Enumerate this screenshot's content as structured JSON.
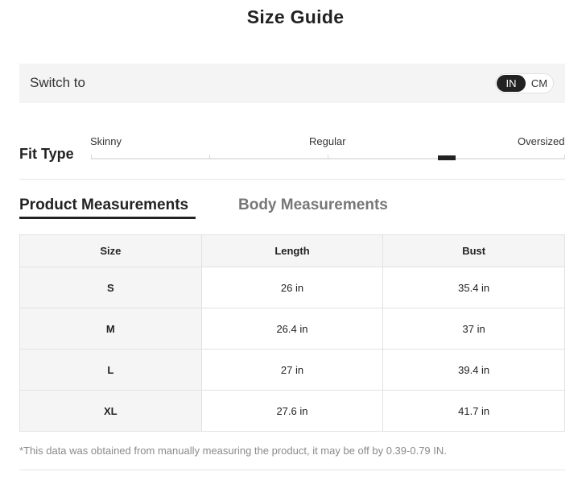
{
  "title": "Size Guide",
  "switch": {
    "label": "Switch to",
    "units": [
      "IN",
      "CM"
    ],
    "selected": "IN"
  },
  "fit": {
    "label": "Fit Type",
    "options": [
      "Skinny",
      "Regular",
      "Oversized"
    ],
    "marker_position": 0.75
  },
  "tabs": [
    {
      "label": "Product Measurements",
      "active": true
    },
    {
      "label": "Body Measurements",
      "active": false
    }
  ],
  "table": {
    "headers": [
      "Size",
      "Length",
      "Bust"
    ],
    "rows": [
      [
        "S",
        "26 in",
        "35.4 in"
      ],
      [
        "M",
        "26.4 in",
        "37 in"
      ],
      [
        "L",
        "27 in",
        "39.4 in"
      ],
      [
        "XL",
        "27.6 in",
        "41.7 in"
      ]
    ]
  },
  "footnote": "*This data was obtained from manually measuring the product, it may be off by 0.39-0.79 IN.",
  "colors": {
    "accent": "#222222",
    "panel": "#f4f4f4",
    "muted_text": "#8a8a8a"
  }
}
